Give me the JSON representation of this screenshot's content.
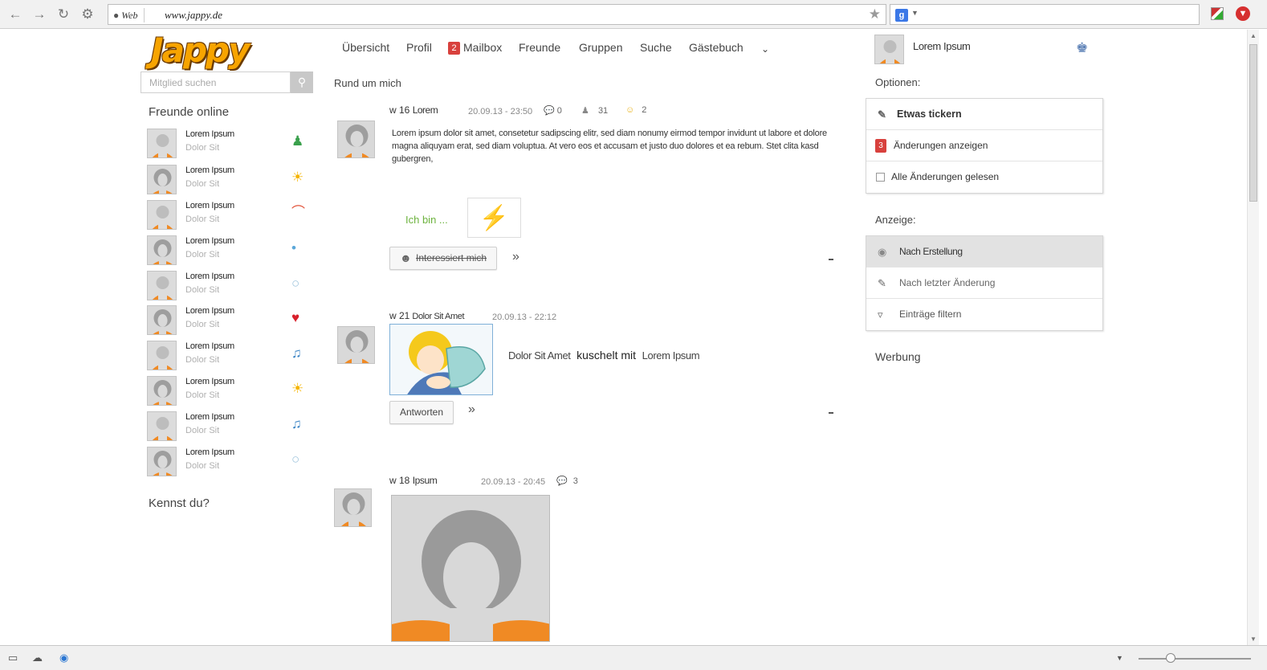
{
  "browser": {
    "url_source": "Web",
    "url": "www.jappy.de",
    "search_engine": "g"
  },
  "logo": {
    "text": "Jappy"
  },
  "member_search": {
    "placeholder": "Mitglied suchen"
  },
  "nav": {
    "items": [
      "Übersicht",
      "Profil",
      "Mailbox",
      "Freunde",
      "Gruppen",
      "Suche",
      "Gästebuch"
    ],
    "mail_badge": "2",
    "more_icon": "chevron-down-icon"
  },
  "user": {
    "name": "Lorem Ipsum"
  },
  "friends_online": {
    "title": "Freunde online",
    "items": [
      {
        "name": "Lorem Ipsum",
        "status": "Dolor Sit",
        "mood": "user-icon"
      },
      {
        "name": "Lorem Ipsum",
        "status": "Dolor Sit",
        "mood": "sun-icon"
      },
      {
        "name": "Lorem Ipsum",
        "status": "Dolor Sit",
        "mood": "rainbow-icon"
      },
      {
        "name": "Lorem Ipsum",
        "status": "Dolor Sit",
        "mood": "drops-icon"
      },
      {
        "name": "Lorem Ipsum",
        "status": "Dolor Sit",
        "mood": "speech-bubble-icon"
      },
      {
        "name": "Lorem Ipsum",
        "status": "Dolor Sit",
        "mood": "heart-icon"
      },
      {
        "name": "Lorem Ipsum",
        "status": "Dolor Sit",
        "mood": "music-note-icon"
      },
      {
        "name": "Lorem Ipsum",
        "status": "Dolor Sit",
        "mood": "sun-icon"
      },
      {
        "name": "Lorem Ipsum",
        "status": "Dolor Sit",
        "mood": "music-note-icon"
      },
      {
        "name": "Lorem Ipsum",
        "status": "Dolor Sit",
        "mood": "speech-bubble-icon"
      }
    ]
  },
  "kennst_du": {
    "title": "Kennst du?"
  },
  "feed": {
    "title": "Rund um mich",
    "posts": [
      {
        "gender_age": "w 16",
        "author": "Lorem",
        "date": "20.09.13 - 23:50",
        "comments": "0",
        "views": "31",
        "likes": "2",
        "text": "Lorem ipsum dolor sit amet, consetetur sadipscing elitr, sed diam nonumy eirmod tempor invidunt ut labore et dolore magna aliquyam erat, sed diam voluptua. At vero eos et accusam et justo duo dolores et ea rebum. Stet clita kasd gubergren,",
        "mood_label": "Ich bin ...",
        "button": "Interessiert mich"
      },
      {
        "gender_age": "w 21",
        "author": "Dolor Sit Amet",
        "date": "20.09.13 - 22:12",
        "action_subject": "Dolor Sit Amet",
        "action": "kuschelt mit",
        "action_object": "Lorem Ipsum",
        "button": "Antworten"
      },
      {
        "gender_age": "w 18",
        "author": "Ipsum",
        "date": "20.09.13 - 20:45",
        "comments": "3"
      }
    ]
  },
  "options": {
    "title": "Optionen:",
    "items": [
      "Etwas tickern",
      "Änderungen anzeigen",
      "Alle Änderungen gelesen"
    ],
    "changes_badge": "3"
  },
  "display": {
    "title": "Anzeige:",
    "items": [
      "Nach Erstellung",
      "Nach letzter Änderung",
      "Einträge filtern"
    ]
  },
  "ads": {
    "title": "Werbung"
  },
  "colors": {
    "accent_red": "#d8413d",
    "mood_green": "#6db33f",
    "logo_orange": "#f7a400"
  }
}
